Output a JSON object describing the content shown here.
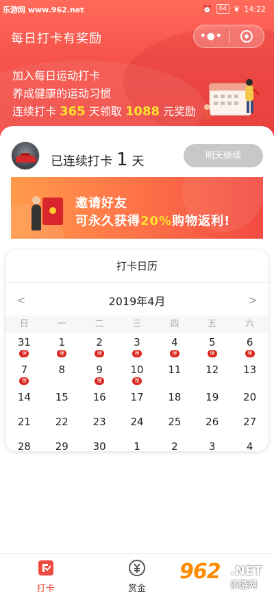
{
  "statusbar": {
    "watermark": "乐游网 www.962.net",
    "battery": "64",
    "time": "14:22"
  },
  "navbar": {
    "title": "每日打卡有奖励",
    "more_icon": "more-dots-icon",
    "close_icon": "capsule-close-icon"
  },
  "promo": {
    "line1": "加入每日运动打卡",
    "line2": "养成健康的运动习惯",
    "line3_prefix": "连续打卡",
    "line3_days": "365",
    "line3_mid": "天领取",
    "line3_amount": "1088",
    "line3_suffix": "元奖励",
    "illustration": "calendar-illustration"
  },
  "user": {
    "avatar": "red-car-avatar",
    "streak_prefix": "已连续打卡",
    "streak_days": "1",
    "streak_suffix": "天",
    "continue_label": "明天继续"
  },
  "banner": {
    "line1": "邀请好友",
    "line2_prefix": "可永久获得",
    "line2_highlight": "20%",
    "line2_suffix": "购物返利!",
    "icon": "red-envelope-icon"
  },
  "calendar": {
    "title": "打卡日历",
    "prev": "<",
    "month": "2019年4月",
    "next": ">",
    "weekdays": [
      "日",
      "一",
      "二",
      "三",
      "四",
      "五",
      "六"
    ],
    "badge_text": "理",
    "rows": [
      [
        {
          "d": "31",
          "tag": true
        },
        {
          "d": "1",
          "tag": true
        },
        {
          "d": "2",
          "tag": true
        },
        {
          "d": "3",
          "tag": true
        },
        {
          "d": "4",
          "tag": true
        },
        {
          "d": "5",
          "tag": true
        },
        {
          "d": "6",
          "tag": true
        }
      ],
      [
        {
          "d": "7",
          "tag": true
        },
        {
          "d": "8",
          "tag": false
        },
        {
          "d": "9",
          "tag": true
        },
        {
          "d": "10",
          "tag": true
        },
        {
          "d": "11",
          "tag": false
        },
        {
          "d": "12",
          "tag": false
        },
        {
          "d": "13",
          "tag": false
        }
      ],
      [
        {
          "d": "14"
        },
        {
          "d": "15"
        },
        {
          "d": "16"
        },
        {
          "d": "17"
        },
        {
          "d": "18"
        },
        {
          "d": "19"
        },
        {
          "d": "20"
        }
      ],
      [
        {
          "d": "21"
        },
        {
          "d": "22"
        },
        {
          "d": "23"
        },
        {
          "d": "24"
        },
        {
          "d": "25"
        },
        {
          "d": "26"
        },
        {
          "d": "27"
        }
      ],
      [
        {
          "d": "28"
        },
        {
          "d": "29"
        },
        {
          "d": "30"
        },
        {
          "d": "1"
        },
        {
          "d": "2"
        },
        {
          "d": "3"
        },
        {
          "d": "4"
        }
      ]
    ]
  },
  "tabs": [
    {
      "label": "打卡",
      "icon": "checkin-icon",
      "active": true
    },
    {
      "label": "赏金",
      "icon": "yuan-coin-icon",
      "active": false
    }
  ],
  "watermark": {
    "big": "962",
    "net": ".NET",
    "cn": "乐游网"
  },
  "colors": {
    "accent": "#ef4b43",
    "highlight": "#ffe12e",
    "badge": "#d9241d"
  }
}
